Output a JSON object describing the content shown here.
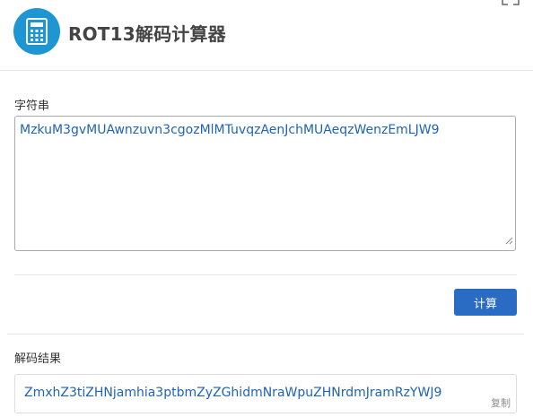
{
  "app": {
    "title": "ROT13解码计算器",
    "brand_color": "#1e96d3"
  },
  "form": {
    "input_label": "字符串",
    "input_value": "MzkuM3gvMUAwnzuvn3cgozMlMTuvqzAenJchMUAeqzWenzEmLJW9",
    "submit_label": "计算"
  },
  "result": {
    "label": "解码结果",
    "value": "ZmxhZ3tiZHNjamhia3ptbmZyZGhidmNraWpuZHNrdmJramRzYWJ9",
    "copy_label": "复制"
  },
  "icons": {
    "logo": "calculator-icon",
    "corner": "fullscreen-icon",
    "resize": "resize-grip-icon"
  }
}
